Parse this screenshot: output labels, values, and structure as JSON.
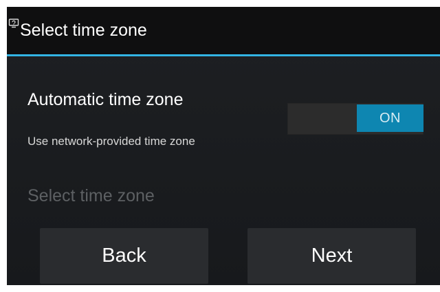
{
  "titlebar": {
    "icon": "monitor-help-icon",
    "title": "Select time zone",
    "accent_color": "#33b5e5"
  },
  "automatic_time_zone": {
    "title": "Automatic time zone",
    "summary": "Use network-provided time zone",
    "toggle": {
      "state": "ON",
      "on_color": "#0e86b1"
    }
  },
  "select_time_zone": {
    "label": "Select time zone",
    "enabled": false
  },
  "buttons": {
    "back_label": "Back",
    "next_label": "Next"
  }
}
